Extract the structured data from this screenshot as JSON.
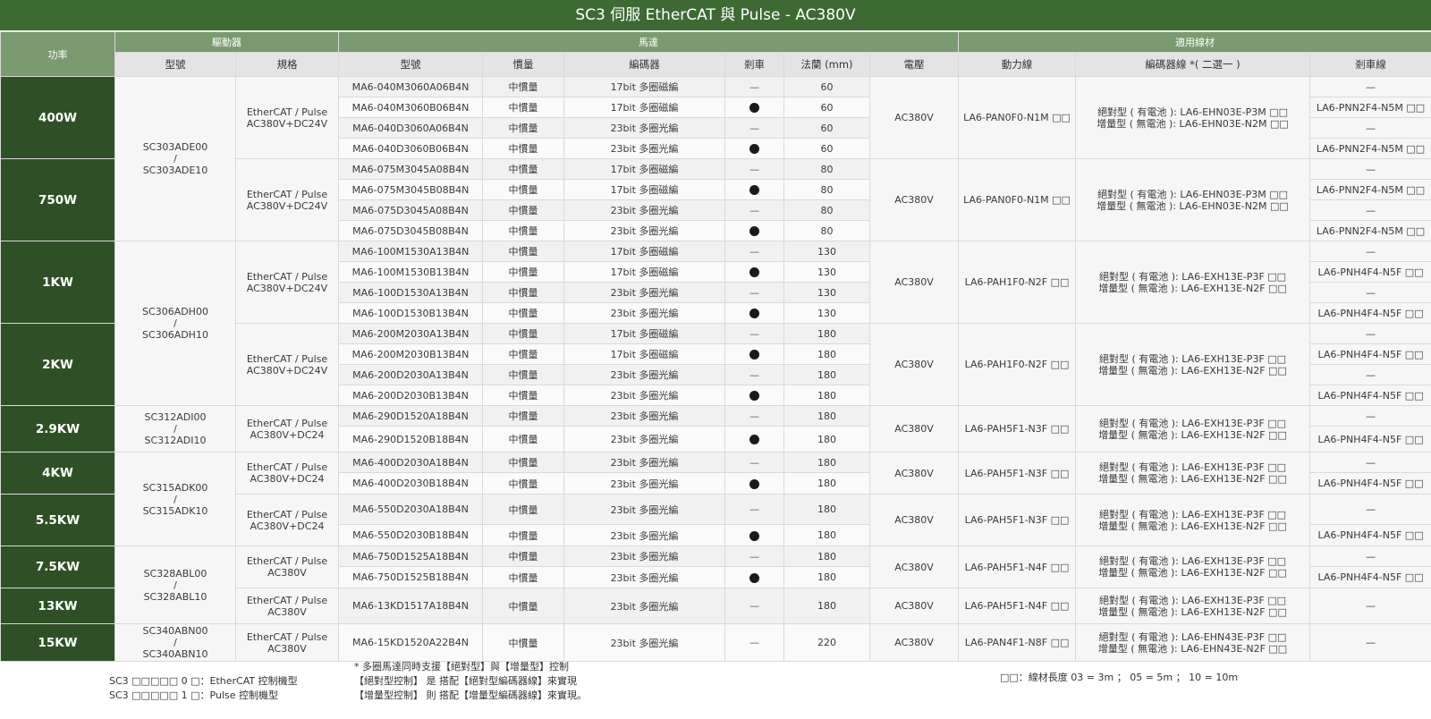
{
  "title": "SC3  伺服 EtherCAT 與 Pulse - AC380V",
  "headers": {
    "power": "功率",
    "driver_group": "驅動器",
    "motor_group": "馬達",
    "cable_group": "適用線材",
    "driver_model": "型號",
    "driver_spec": "規格",
    "motor_model": "型號",
    "inertia": "慣量",
    "encoder": "編碼器",
    "brake": "剎車",
    "flange": "法蘭 (mm)",
    "voltage": "電壓",
    "power_cable": "動力線",
    "encoder_cable": "編碼器線 *( 二選一 )",
    "brake_cable": "剎車線"
  },
  "rows": [
    {
      "model": "MA6-040M3060A06B4N",
      "inertia": "中慣量",
      "encoder": "17bit 多圈磁編",
      "brake": false,
      "flange": "60",
      "brake_cable": "—"
    },
    {
      "model": "MA6-040M3060B06B4N",
      "inertia": "中慣量",
      "encoder": "17bit 多圈磁編",
      "brake": true,
      "flange": "60",
      "brake_cable": "LA6-PNN2F4-N5M □□"
    },
    {
      "model": "MA6-040D3060A06B4N",
      "inertia": "中慣量",
      "encoder": "23bit 多圈光編",
      "brake": false,
      "flange": "60",
      "brake_cable": "—"
    },
    {
      "model": "MA6-040D3060B06B4N",
      "inertia": "中慣量",
      "encoder": "23bit 多圈光編",
      "brake": true,
      "flange": "60",
      "brake_cable": "LA6-PNN2F4-N5M □□"
    },
    {
      "model": "MA6-075M3045A08B4N",
      "inertia": "中慣量",
      "encoder": "17bit 多圈磁編",
      "brake": false,
      "flange": "80",
      "brake_cable": "—"
    },
    {
      "model": "MA6-075M3045B08B4N",
      "inertia": "中慣量",
      "encoder": "17bit 多圈磁編",
      "brake": true,
      "flange": "80",
      "brake_cable": "LA6-PNN2F4-N5M □□"
    },
    {
      "model": "MA6-075D3045A08B4N",
      "inertia": "中慣量",
      "encoder": "23bit 多圈光編",
      "brake": false,
      "flange": "80",
      "brake_cable": "—"
    },
    {
      "model": "MA6-075D3045B08B4N",
      "inertia": "中慣量",
      "encoder": "23bit 多圈光編",
      "brake": true,
      "flange": "80",
      "brake_cable": "LA6-PNN2F4-N5M □□"
    },
    {
      "model": "MA6-100M1530A13B4N",
      "inertia": "中慣量",
      "encoder": "17bit 多圈磁編",
      "brake": false,
      "flange": "130",
      "brake_cable": "—"
    },
    {
      "model": "MA6-100M1530B13B4N",
      "inertia": "中慣量",
      "encoder": "17bit 多圈磁編",
      "brake": true,
      "flange": "130",
      "brake_cable": "LA6-PNH4F4-N5F □□"
    },
    {
      "model": "MA6-100D1530A13B4N",
      "inertia": "中慣量",
      "encoder": "23bit 多圈光編",
      "brake": false,
      "flange": "130",
      "brake_cable": "—"
    },
    {
      "model": "MA6-100D1530B13B4N",
      "inertia": "中慣量",
      "encoder": "23bit 多圈光編",
      "brake": true,
      "flange": "130",
      "brake_cable": "LA6-PNH4F4-N5F □□"
    },
    {
      "model": "MA6-200M2030A13B4N",
      "inertia": "中慣量",
      "encoder": "17bit 多圈磁編",
      "brake": false,
      "flange": "180",
      "brake_cable": "—"
    },
    {
      "model": "MA6-200M2030B13B4N",
      "inertia": "中慣量",
      "encoder": "17bit 多圈磁編",
      "brake": true,
      "flange": "180",
      "brake_cable": "LA6-PNH4F4-N5F □□"
    },
    {
      "model": "MA6-200D2030A13B4N",
      "inertia": "中慣量",
      "encoder": "23bit 多圈光編",
      "brake": false,
      "flange": "180",
      "brake_cable": "—"
    },
    {
      "model": "MA6-200D2030B13B4N",
      "inertia": "中慣量",
      "encoder": "23bit 多圈光編",
      "brake": true,
      "flange": "180",
      "brake_cable": "LA6-PNH4F4-N5F □□"
    },
    {
      "model": "MA6-290D1520A18B4N",
      "inertia": "中慣量",
      "encoder": "23bit 多圈光編",
      "brake": false,
      "flange": "180",
      "brake_cable": "—"
    },
    {
      "model": "MA6-290D1520B18B4N",
      "inertia": "中慣量",
      "encoder": "23bit 多圈光編",
      "brake": true,
      "flange": "180",
      "brake_cable": "LA6-PNH4F4-N5F □□"
    },
    {
      "model": "MA6-400D2030A18B4N",
      "inertia": "中慣量",
      "encoder": "23bit 多圈光編",
      "brake": false,
      "flange": "180",
      "brake_cable": "—"
    },
    {
      "model": "MA6-400D2030B18B4N",
      "inertia": "中慣量",
      "encoder": "23bit 多圈光編",
      "brake": true,
      "flange": "180",
      "brake_cable": "LA6-PNH4F4-N5F □□"
    },
    {
      "model": "MA6-550D2030A18B4N",
      "inertia": "中慣量",
      "encoder": "23bit 多圈光編",
      "brake": false,
      "flange": "180",
      "brake_cable": "—"
    },
    {
      "model": "MA6-550D2030B18B4N",
      "inertia": "中慣量",
      "encoder": "23bit 多圈光編",
      "brake": true,
      "flange": "180",
      "brake_cable": "LA6-PNH4F4-N5F □□"
    },
    {
      "model": "MA6-750D1525A18B4N",
      "inertia": "中慣量",
      "encoder": "23bit 多圈光編",
      "brake": false,
      "flange": "180",
      "brake_cable": "—"
    },
    {
      "model": "MA6-750D1525B18B4N",
      "inertia": "中慣量",
      "encoder": "23bit 多圈光編",
      "brake": true,
      "flange": "180",
      "brake_cable": "LA6-PNH4F4-N5F □□"
    },
    {
      "model": "MA6-13KD1517A18B4N",
      "inertia": "中慣量",
      "encoder": "23bit 多圈光編",
      "brake": false,
      "flange": "180",
      "brake_cable": "—"
    },
    {
      "model": "MA6-15KD1520A22B4N",
      "inertia": "中慣量",
      "encoder": "23bit 多圈光編",
      "brake": false,
      "flange": "220",
      "brake_cable": "—"
    }
  ],
  "power_groups": [
    {
      "label": "400W",
      "span": 4,
      "voltage": "AC380V",
      "power_cable": "LA6-PAN0F0-N1M □□",
      "enc_abs": "絕對型 ( 有電池 ): LA6-EHN03E-P3M □□",
      "enc_inc": "增量型 ( 無電池 ): LA6-EHN03E-N2M □□"
    },
    {
      "label": "750W",
      "span": 4,
      "voltage": "AC380V",
      "power_cable": "LA6-PAN0F0-N1M □□",
      "enc_abs": "絕對型 ( 有電池 ): LA6-EHN03E-P3M □□",
      "enc_inc": "增量型 ( 無電池 ): LA6-EHN03E-N2M □□"
    },
    {
      "label": "1KW",
      "span": 4,
      "voltage": "AC380V",
      "power_cable": "LA6-PAH1F0-N2F □□",
      "enc_abs": "絕對型 ( 有電池 ): LA6-EXH13E-P3F □□",
      "enc_inc": "增量型 ( 無電池 ): LA6-EXH13E-N2F □□"
    },
    {
      "label": "2KW",
      "span": 4,
      "voltage": "AC380V",
      "power_cable": "LA6-PAH1F0-N2F □□",
      "enc_abs": "絕對型 ( 有電池 ): LA6-EXH13E-P3F □□",
      "enc_inc": "增量型 ( 無電池 ): LA6-EXH13E-N2F □□"
    },
    {
      "label": "2.9KW",
      "span": 2,
      "voltage": "AC380V",
      "power_cable": "LA6-PAH5F1-N3F □□",
      "enc_abs": "絕對型 ( 有電池 ): LA6-EXH13E-P3F □□",
      "enc_inc": "增量型 ( 無電池 ): LA6-EXH13E-N2F □□"
    },
    {
      "label": "4KW",
      "span": 2,
      "voltage": "AC380V",
      "power_cable": "LA6-PAH5F1-N3F □□",
      "enc_abs": "絕對型 ( 有電池 ): LA6-EXH13E-P3F □□",
      "enc_inc": "增量型 ( 無電池 ): LA6-EXH13E-N2F □□"
    },
    {
      "label": "5.5KW",
      "span": 2,
      "voltage": "AC380V",
      "power_cable": "LA6-PAH5F1-N3F □□",
      "enc_abs": "絕對型 ( 有電池 ): LA6-EXH13E-P3F □□",
      "enc_inc": "增量型 ( 無電池 ): LA6-EXH13E-N2F □□"
    },
    {
      "label": "7.5KW",
      "span": 2,
      "voltage": "AC380V",
      "power_cable": "LA6-PAH5F1-N4F □□",
      "enc_abs": "絕對型 ( 有電池 ): LA6-EXH13E-P3F □□",
      "enc_inc": "增量型 ( 無電池 ): LA6-EXH13E-N2F □□"
    },
    {
      "label": "13KW",
      "span": 1,
      "voltage": "AC380V",
      "power_cable": "LA6-PAH5F1-N4F □□",
      "enc_abs": "絕對型 ( 有電池 ): LA6-EXH13E-P3F □□",
      "enc_inc": "增量型 ( 無電池 ): LA6-EXH13E-N2F □□"
    },
    {
      "label": "15KW",
      "span": 1,
      "voltage": "AC380V",
      "power_cable": "LA6-PAN4F1-N8F □□",
      "enc_abs": "絕對型 ( 有電池 ): LA6-EHN43E-P3F □□",
      "enc_inc": "增量型 ( 無電池 ): LA6-EHN43E-N2F □□"
    }
  ],
  "driver_model_groups": [
    {
      "span": 8,
      "model_a": "SC303ADE00",
      "sep": "/",
      "model_b": "SC303ADE10"
    },
    {
      "span": 8,
      "model_a": "SC306ADH00",
      "sep": "/",
      "model_b": "SC306ADH10"
    },
    {
      "span": 2,
      "model_a": "SC312ADI00",
      "sep": "/",
      "model_b": "SC312ADI10"
    },
    {
      "span": 4,
      "model_a": "SC315ADK00",
      "sep": "/",
      "model_b": "SC315ADK10"
    },
    {
      "span": 3,
      "model_a": "SC328ABL00",
      "sep": "/",
      "model_b": "SC328ABL10"
    },
    {
      "span": 1,
      "model_a": "SC340ABN00",
      "sep": "/",
      "model_b": "SC340ABN10"
    }
  ],
  "driver_spec_groups": [
    {
      "span": 4,
      "line1": "EtherCAT / Pulse",
      "line2": "AC380V+DC24V"
    },
    {
      "span": 4,
      "line1": "EtherCAT / Pulse",
      "line2": "AC380V+DC24V"
    },
    {
      "span": 4,
      "line1": "EtherCAT / Pulse",
      "line2": "AC380V+DC24V"
    },
    {
      "span": 4,
      "line1": "EtherCAT / Pulse",
      "line2": "AC380V+DC24V"
    },
    {
      "span": 2,
      "line1": "EtherCAT / Pulse",
      "line2": "AC380V+DC24"
    },
    {
      "span": 2,
      "line1": "EtherCAT / Pulse",
      "line2": "AC380V+DC24"
    },
    {
      "span": 2,
      "line1": "EtherCAT / Pulse",
      "line2": "AC380V+DC24"
    },
    {
      "span": 2,
      "line1": "EtherCAT / Pulse",
      "line2": "AC380V"
    },
    {
      "span": 1,
      "line1": "EtherCAT / Pulse",
      "line2": "AC380V"
    },
    {
      "span": 1,
      "line1": "EtherCAT / Pulse",
      "line2": "AC380V"
    }
  ],
  "notes": {
    "left_line1": "SC3 □□□□□ 0 □：EtherCAT 控制機型",
    "left_line2": "SC3 □□□□□ 1 □：Pulse 控制機型",
    "mid_line1": "* 多圈馬達同時支援【絕對型】與【增量型】控制",
    "mid_line2": "【絕對型控制】 是 搭配【絕對型編碼器線】來實現",
    "mid_line3": "【增量型控制】 則 搭配【增量型編碼器線】來實現。",
    "right_line1": "□□：線材長度  03 = 3m ； 05 = 5m ； 10 = 10m"
  },
  "colors": {
    "title_bg": "#3d6a33",
    "group_header_bg": "#7b9a70",
    "power_cell_bg": "#2f5027",
    "sub_header_bg": "#e4e4e4"
  },
  "icons": {
    "brake_yes": "filled-dot",
    "brake_no": "dash"
  }
}
